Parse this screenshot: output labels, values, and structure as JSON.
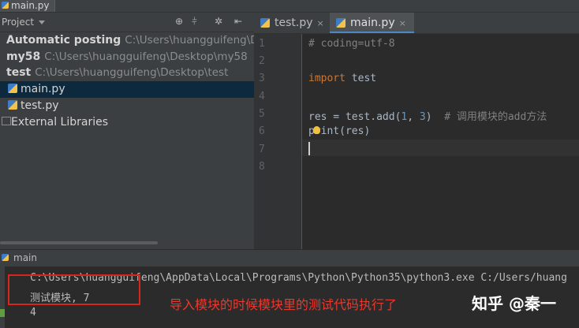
{
  "breadcrumb": {
    "file": "main.py"
  },
  "project_panel": {
    "title": "Project",
    "tools": [
      "⊕",
      "⫩",
      "✲",
      "⇤"
    ],
    "items": [
      {
        "name": "Automatic posting",
        "path": "C:\\Users\\huangguifeng\\D",
        "bold": true
      },
      {
        "name": "my58",
        "path": "C:\\Users\\huangguifeng\\Desktop\\my58",
        "bold": true
      },
      {
        "name": "test",
        "path": "C:\\Users\\huangguifeng\\Desktop\\test",
        "bold": true
      },
      {
        "name": "main.py",
        "selected": true,
        "icon": "python-file-icon"
      },
      {
        "name": "test.py",
        "icon": "python-file-icon"
      },
      {
        "name": "External Libraries",
        "icon": "library-icon"
      }
    ]
  },
  "editor": {
    "tabs": [
      {
        "label": "test.py",
        "close": "×",
        "active": false
      },
      {
        "label": "main.py",
        "close": "×",
        "active": true
      }
    ],
    "line_numbers": [
      "1",
      "2",
      "3",
      "4",
      "5",
      "6",
      "7",
      "8"
    ],
    "lines": {
      "l1_comment": "# coding=utf-8",
      "l3_kw": "import",
      "l3_rest": " test",
      "l5_a": "res = test.add(",
      "l5_n1": "1",
      "l5_b": ", ",
      "l5_n2": "3",
      "l5_c": ")  ",
      "l5_comment": "# 调用模块的add方法",
      "l6": "print(res)"
    }
  },
  "run_panel": {
    "title": "main",
    "output": [
      "C:\\Users\\huangguifeng\\AppData\\Local\\Programs\\Python\\Python35\\python3.exe C:/Users/huang",
      "测试模块, 7",
      "4"
    ]
  },
  "annotation": "导入模块的时候模块里的测试代码执行了",
  "watermark": "知乎 @秦一",
  "colors": {
    "keyword": "#cc7832",
    "number": "#6897bb",
    "comment": "#808080",
    "annotation": "#e8392e",
    "selection": "#0d293e"
  }
}
